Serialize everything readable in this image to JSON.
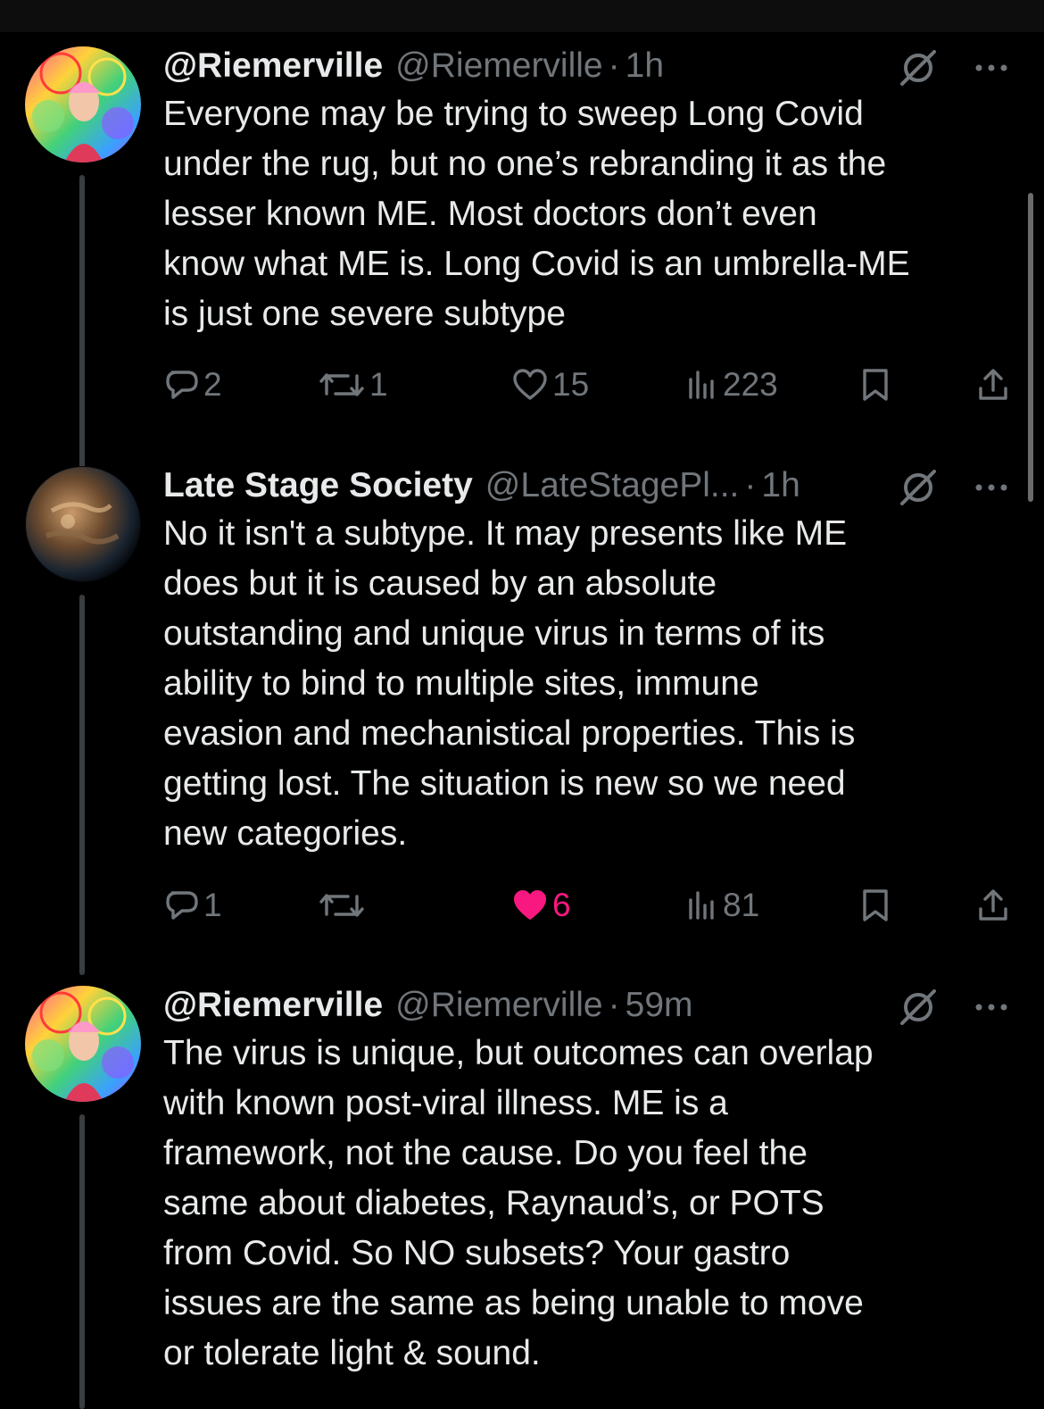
{
  "tweets": [
    {
      "name": "@Riemerville",
      "handle": "@Riemerville",
      "dot": "·",
      "time": "1h",
      "text": "Everyone may be trying to sweep Long Covid\nunder the rug, but no one’s rebranding it as the\nlesser known ME. Most doctors don’t even\nknow what ME is. Long Covid is an umbrella-ME\nis just one severe subtype",
      "replies": "2",
      "reposts": "1",
      "likes": "15",
      "views": "223",
      "liked": false
    },
    {
      "name": "Late Stage Society",
      "handle": "@LateStagePl...",
      "dot": "·",
      "time": "1h",
      "text": "No it isn't a subtype. It may presents like ME\ndoes but it is caused by an absolute\noutstanding and unique virus in terms of its\nability to bind to multiple sites, immune\nevasion and mechanistical properties. This is\ngetting lost. The situation is new so we need\nnew categories.",
      "replies": "1",
      "reposts": "",
      "likes": "6",
      "views": "81",
      "liked": true
    },
    {
      "name": "@Riemerville",
      "handle": "@Riemerville",
      "dot": "·",
      "time": "59m",
      "text": "The virus is unique, but outcomes can overlap\nwith known post-viral illness. ME is a\nframework, not the cause. Do you feel the\nsame about diabetes, Raynaud’s, or POTS\nfrom Covid. So NO subsets? Your gastro\nissues are the same as being unable to move\nor tolerate light & sound."
    }
  ],
  "colors": {
    "background": "#000000",
    "text": "#e7e9ea",
    "secondary": "#71767b",
    "like": "#f91880"
  },
  "icons": [
    "reply-icon",
    "repost-icon",
    "like-icon",
    "views-icon",
    "bookmark-icon",
    "share-icon",
    "grok-icon",
    "more-icon"
  ]
}
